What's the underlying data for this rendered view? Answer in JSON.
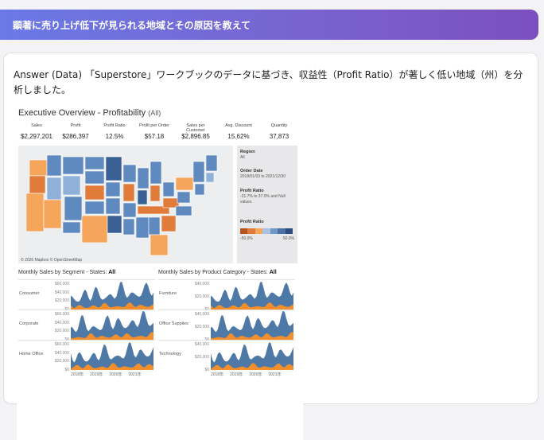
{
  "question": "顕著に売り上げ低下が見られる地域とその原因を教えて",
  "answer": "Answer (Data) 「Superstore」ワークブックのデータに基づき、収益性（Profit Ratio）が著しく低い地域（州）を分析しました。",
  "dashboard": {
    "title": "Executive Overview - Profitability",
    "title_suffix": "(All)",
    "kpis": [
      {
        "label": "Sales",
        "value": "$2,297,201"
      },
      {
        "label": "Profit",
        "value": "$286,397"
      },
      {
        "label": "Profit Ratio",
        "value": "12.5%"
      },
      {
        "label": "Profit per Order",
        "value": "$57.18"
      },
      {
        "label": "Sales per Customer",
        "value": "$2,896.85"
      },
      {
        "label": "Avg. Discount",
        "value": "15.62%"
      },
      {
        "label": "Quantity",
        "value": "37,873"
      }
    ],
    "map_credit": "© 2026 Mapbox © OpenStreetMap",
    "filters": {
      "region_label": "Region",
      "region_value": "All",
      "order_date_label": "Order Date",
      "order_date_value": "2018/01/03 to 2021/12/30",
      "profit_ratio_label": "Profit Ratio",
      "profit_ratio_value": "-21.7% to 37.0% and Null values",
      "legend_label": "Profit Ratio",
      "legend_min": "-50.0%",
      "legend_max": "50.0%"
    },
    "legend_colors": [
      "#b5541f",
      "#e07b39",
      "#f6a65b",
      "#a9c2df",
      "#6f98c8",
      "#4a72a8",
      "#2d4d80"
    ],
    "map_colors": {
      "blue_light": "#8fb0d8",
      "blue": "#5f8ac0",
      "blue_dark": "#3a5f95",
      "orange_light": "#f6a65b",
      "orange": "#e07b39",
      "ocean": "#eceef0"
    },
    "segment_title": "Monthly Sales by Segment - States:",
    "segment_title_value": "All",
    "category_title": "Monthly Sales by Product Category - States:",
    "category_title_value": "All",
    "segments": [
      "Consumer",
      "Corporate",
      "Home Office"
    ],
    "categories": [
      "Furniture",
      "Office Supplies",
      "Technology"
    ],
    "seg_ticks": [
      "$60,000",
      "$40,000",
      "$20,000",
      "$0"
    ],
    "cat_ticks": [
      "$40,000",
      "$20,000",
      "$0"
    ],
    "years": [
      "2018年",
      "2019年",
      "2020年",
      "2021年"
    ],
    "chart_data": [
      {
        "type": "area",
        "title": "Monthly Sales by Segment - States: All",
        "series": [
          {
            "name": "Consumer"
          },
          {
            "name": "Corporate"
          },
          {
            "name": "Home Office"
          }
        ],
        "x": [
          "2018年",
          "2019年",
          "2020年",
          "2021年"
        ]
      },
      {
        "type": "area",
        "title": "Monthly Sales by Product Category - States: All",
        "series": [
          {
            "name": "Furniture"
          },
          {
            "name": "Office Supplies"
          },
          {
            "name": "Technology"
          }
        ],
        "x": [
          "2018年",
          "2019年",
          "2020年",
          "2021年"
        ]
      }
    ]
  }
}
